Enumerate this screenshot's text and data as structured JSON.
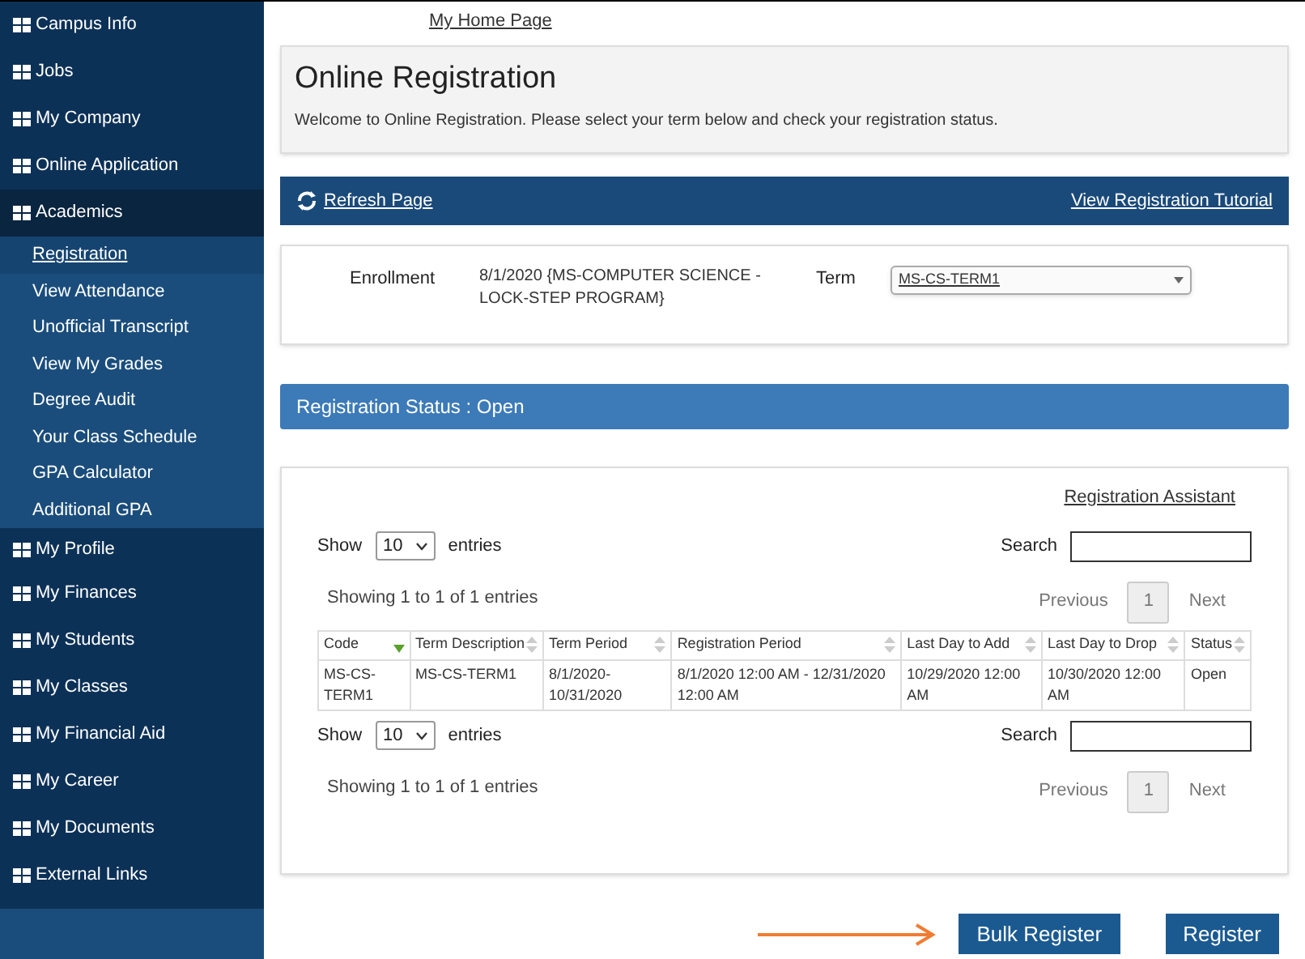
{
  "sidebar": {
    "items": [
      {
        "label": "Campus Info",
        "expanded": false
      },
      {
        "label": "Jobs",
        "expanded": false
      },
      {
        "label": "My Company",
        "expanded": false
      },
      {
        "label": "Online Application",
        "expanded": false
      },
      {
        "label": "Academics",
        "expanded": true,
        "children": [
          {
            "label": "Registration",
            "selected": true
          },
          {
            "label": "View Attendance",
            "selected": false
          },
          {
            "label": "Unofficial Transcript",
            "selected": false
          },
          {
            "label": "View My Grades",
            "selected": false
          },
          {
            "label": "Degree Audit",
            "selected": false
          },
          {
            "label": "Your Class Schedule",
            "selected": false
          },
          {
            "label": "GPA Calculator",
            "selected": false
          },
          {
            "label": "Additional GPA",
            "selected": false
          }
        ]
      },
      {
        "label": "My Profile",
        "expanded": false
      },
      {
        "label": "My Finances",
        "expanded": false
      },
      {
        "label": "My Students",
        "expanded": false
      },
      {
        "label": "My Classes",
        "expanded": false
      },
      {
        "label": "My Financial Aid",
        "expanded": false
      },
      {
        "label": "My Career",
        "expanded": false
      },
      {
        "label": "My Documents",
        "expanded": false
      },
      {
        "label": "External Links",
        "expanded": false
      }
    ]
  },
  "home_link": "My Home Page",
  "header": {
    "title": "Online Registration",
    "text": "Welcome to Online Registration. Please select your term below and check your registration status."
  },
  "toolbar": {
    "refresh": "Refresh Page",
    "tutorial": "View Registration Tutorial"
  },
  "enrollment": {
    "label": "Enrollment",
    "value": "8/1/2020 {MS-COMPUTER SCIENCE - LOCK-STEP PROGRAM}",
    "term_label": "Term",
    "term_value": "MS-CS-TERM1"
  },
  "status_bar": "Registration Status : Open",
  "table_panel": {
    "assistant_link": "Registration Assistant",
    "top_controls": {
      "show": "Show",
      "page_size": "10",
      "entries": "entries",
      "search": "Search"
    },
    "info": "Showing 1 to 1 of 1 entries",
    "pagination": [
      {
        "label": "Previous",
        "kind": "link"
      },
      {
        "label": "1",
        "kind": "page",
        "selected": true
      },
      {
        "label": "Next",
        "kind": "link"
      }
    ],
    "columns": [
      {
        "label": "Code",
        "sorted": true
      },
      {
        "label": "Term Description",
        "sorted": false
      },
      {
        "label": "Term Period",
        "sorted": false
      },
      {
        "label": "Registration Period",
        "sorted": false
      },
      {
        "label": "Last Day to Add",
        "sorted": false
      },
      {
        "label": "Last Day to Drop",
        "sorted": false
      },
      {
        "label": "Status",
        "sorted": false
      }
    ],
    "rows": [
      [
        "MS-CS-TERM1",
        "MS-CS-TERM1",
        "8/1/2020-10/31/2020",
        "8/1/2020 12:00 AM - 12/31/2020 12:00 AM",
        "10/29/2020 12:00 AM",
        "10/30/2020 12:00 AM",
        "Open"
      ]
    ],
    "bottom_controls": {
      "show": "Show",
      "page_size": "10",
      "entries": "entries",
      "search": "Search"
    },
    "bottom_info": "Showing 1 to 1 of 1 entries",
    "bottom_pagination": [
      {
        "label": "Previous",
        "kind": "link"
      },
      {
        "label": "1",
        "kind": "page",
        "selected": true
      },
      {
        "label": "Next",
        "kind": "link"
      }
    ]
  },
  "buttons": [
    "Bulk Register",
    "Register"
  ]
}
